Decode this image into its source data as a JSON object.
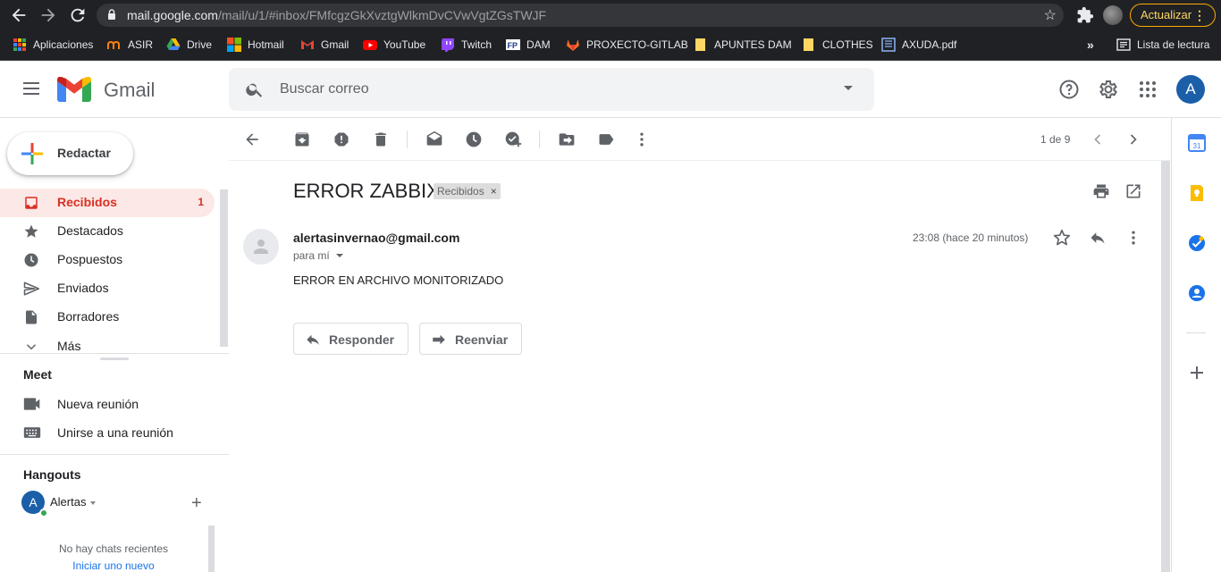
{
  "browser": {
    "url_host": "mail.google.com",
    "url_path": "/mail/u/1/#inbox/FMfcgzGkXvztgWlkmDvCVwVgtZGsTWJF",
    "update_label": "Actualizar",
    "bookmarks": [
      {
        "label": "Aplicaciones",
        "icon": "apps-grid-icon"
      },
      {
        "label": "ASIR",
        "icon": "moodle-icon"
      },
      {
        "label": "Drive",
        "icon": "drive-icon"
      },
      {
        "label": "Hotmail",
        "icon": "windows-icon"
      },
      {
        "label": "Gmail",
        "icon": "gmail-icon"
      },
      {
        "label": "YouTube",
        "icon": "youtube-icon"
      },
      {
        "label": "Twitch",
        "icon": "twitch-icon"
      },
      {
        "label": "DAM",
        "icon": "fp-icon"
      },
      {
        "label": "PROXECTO-GITLAB",
        "icon": "gitlab-icon"
      },
      {
        "label": "APUNTES DAM",
        "icon": "folder-icon"
      },
      {
        "label": "CLOTHES",
        "icon": "folder-icon"
      },
      {
        "label": "AXUDA.pdf",
        "icon": "pdf-icon"
      }
    ],
    "overflow_label": "»",
    "reading_list_label": "Lista de lectura"
  },
  "header": {
    "app_name": "Gmail",
    "search_placeholder": "Buscar correo",
    "avatar_letter": "A"
  },
  "sidebar": {
    "compose_label": "Redactar",
    "items": [
      {
        "label": "Recibidos",
        "count": "1",
        "icon": "inbox-icon",
        "active": true
      },
      {
        "label": "Destacados",
        "count": "",
        "icon": "star-icon",
        "active": false
      },
      {
        "label": "Pospuestos",
        "count": "",
        "icon": "clock-icon",
        "active": false
      },
      {
        "label": "Enviados",
        "count": "",
        "icon": "send-icon",
        "active": false
      },
      {
        "label": "Borradores",
        "count": "",
        "icon": "draft-icon",
        "active": false
      },
      {
        "label": "Más",
        "count": "",
        "icon": "chevron-down-icon",
        "active": false
      }
    ],
    "meet": {
      "title": "Meet",
      "new_meeting": "Nueva reunión",
      "join_meeting": "Unirse a una reunión"
    },
    "hangouts": {
      "title": "Hangouts",
      "user_letter": "A",
      "user_name": "Alertas",
      "no_chats": "No hay chats recientes",
      "start_new": "Iniciar uno nuevo"
    }
  },
  "toolbar": {
    "pager": "1 de 9"
  },
  "message": {
    "subject": "ERROR ZABBIX",
    "label": "Recibidos",
    "label_close": "×",
    "sender": "alertasinvernao@gmail.com",
    "to": "para mí",
    "time": "23:08 (hace 20 minutos)",
    "body": "ERROR EN ARCHIVO MONITORIZADO",
    "reply_label": "Responder",
    "forward_label": "Reenviar"
  },
  "colors": {
    "accent_red": "#d93025",
    "active_bg": "#fce8e6",
    "link_blue": "#1a73e8",
    "avatar_blue": "#1a5fa8",
    "chrome_dark": "#202124"
  }
}
